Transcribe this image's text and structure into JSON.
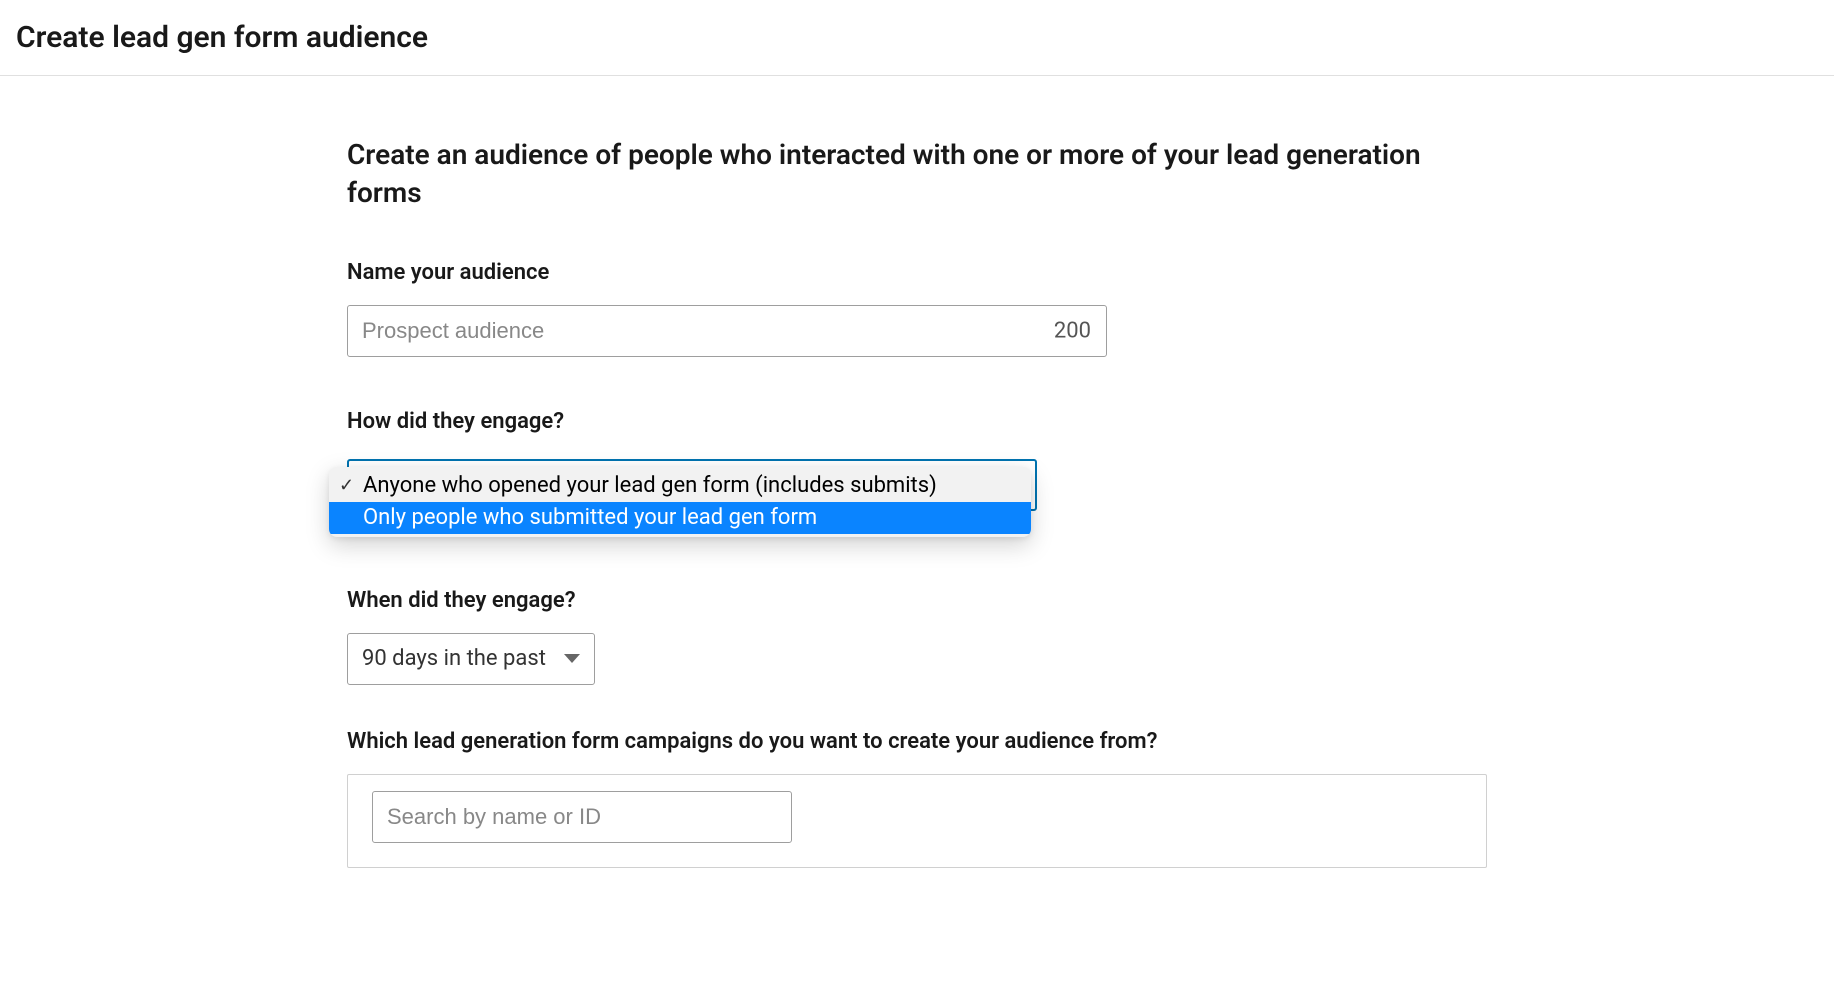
{
  "header": {
    "title": "Create lead gen form audience"
  },
  "main": {
    "heading": "Create an audience of people who interacted with one or more of your lead generation forms",
    "name_field": {
      "label": "Name your audience",
      "placeholder": "Prospect audience",
      "char_limit": "200"
    },
    "engage_field": {
      "label": "How did they engage?",
      "options": [
        "Anyone who opened your lead gen form (includes submits)",
        "Only people who submitted your lead gen form"
      ],
      "selected_index": 0,
      "highlighted_index": 1
    },
    "when_field": {
      "label": "When did they engage?",
      "selected": "90 days in the past"
    },
    "campaign_field": {
      "label": "Which lead generation form campaigns do you want to create your audience from?",
      "search_placeholder": "Search by name or ID"
    }
  }
}
